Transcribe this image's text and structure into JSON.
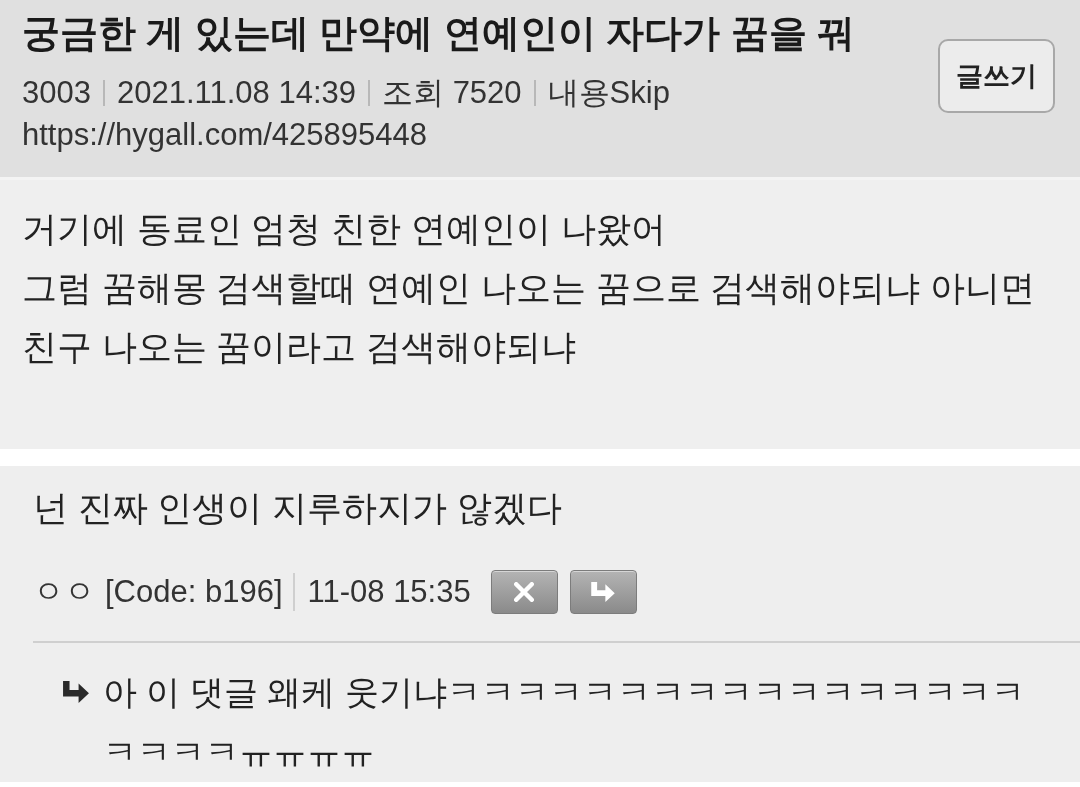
{
  "post": {
    "title": "궁금한 게 있는데 만약에 연예인이 자다가 꿈을 꿔",
    "meta": [
      "3003",
      "2021.11.08 14:39",
      "조회 7520",
      "내용Skip"
    ],
    "url": "https://hygall.com/425895448",
    "write_button": "글쓰기",
    "body": [
      "거기에 동료인 엄청 친한 연예인이 나왔어",
      "그럼 꿈해몽 검색할때 연예인 나오는 꿈으로 검색해야되냐 아니면",
      "친구 나오는 꿈이라고 검색해야되냐"
    ]
  },
  "comments": [
    {
      "text": "넌 진짜 인생이 지루하지가 않겠다",
      "author": "ㅇㅇ",
      "code": "[Code: b196]",
      "time": "11-08 15:35",
      "actions": [
        {
          "kind": "delete"
        },
        {
          "kind": "reply"
        }
      ],
      "replies": [
        {
          "text": "아 이 댓글 왜케 웃기냐ㅋㅋㅋㅋㅋㅋㅋㅋㅋㅋㅋㅋㅋㅋㅋㅋㅋㅋㅋㅋㅋㅠㅠㅠㅠ"
        }
      ]
    }
  ]
}
